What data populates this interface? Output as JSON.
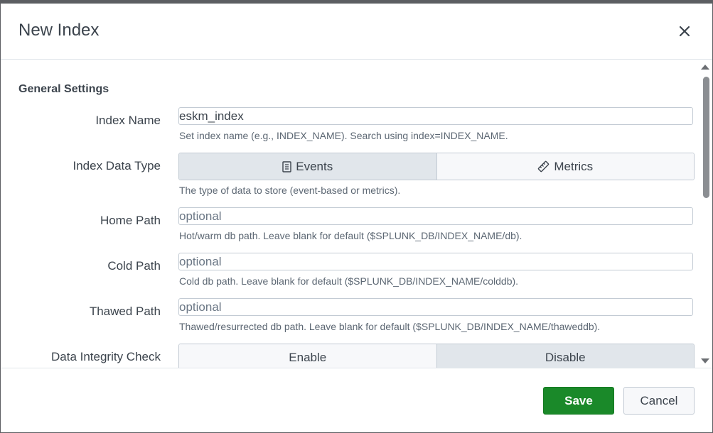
{
  "dialog": {
    "title": "New Index",
    "close_icon": "close-icon"
  },
  "general_settings": {
    "section_title": "General Settings",
    "index_name": {
      "label": "Index Name",
      "value": "eskm_index",
      "help": "Set index name (e.g., INDEX_NAME). Search using index=INDEX_NAME."
    },
    "index_data_type": {
      "label": "Index Data Type",
      "options": [
        {
          "label": "Events",
          "icon": "document-icon",
          "selected": true
        },
        {
          "label": "Metrics",
          "icon": "ruler-icon",
          "selected": false
        }
      ],
      "help": "The type of data to store (event-based or metrics)."
    },
    "home_path": {
      "label": "Home Path",
      "placeholder": "optional",
      "help": "Hot/warm db path. Leave blank for default ($SPLUNK_DB/INDEX_NAME/db)."
    },
    "cold_path": {
      "label": "Cold Path",
      "placeholder": "optional",
      "help": "Cold db path. Leave blank for default ($SPLUNK_DB/INDEX_NAME/colddb)."
    },
    "thawed_path": {
      "label": "Thawed Path",
      "placeholder": "optional",
      "help": "Thawed/resurrected db path. Leave blank for default ($SPLUNK_DB/INDEX_NAME/thaweddb)."
    },
    "data_integrity_check": {
      "label": "Data Integrity Check",
      "options": [
        {
          "label": "Enable",
          "selected": false
        },
        {
          "label": "Disable",
          "selected": true
        }
      ]
    }
  },
  "footer": {
    "save_label": "Save",
    "cancel_label": "Cancel"
  },
  "colors": {
    "save_button": "#1a8929",
    "toggle_active": "#e1e6eb",
    "overlay": "#5c5e62"
  }
}
